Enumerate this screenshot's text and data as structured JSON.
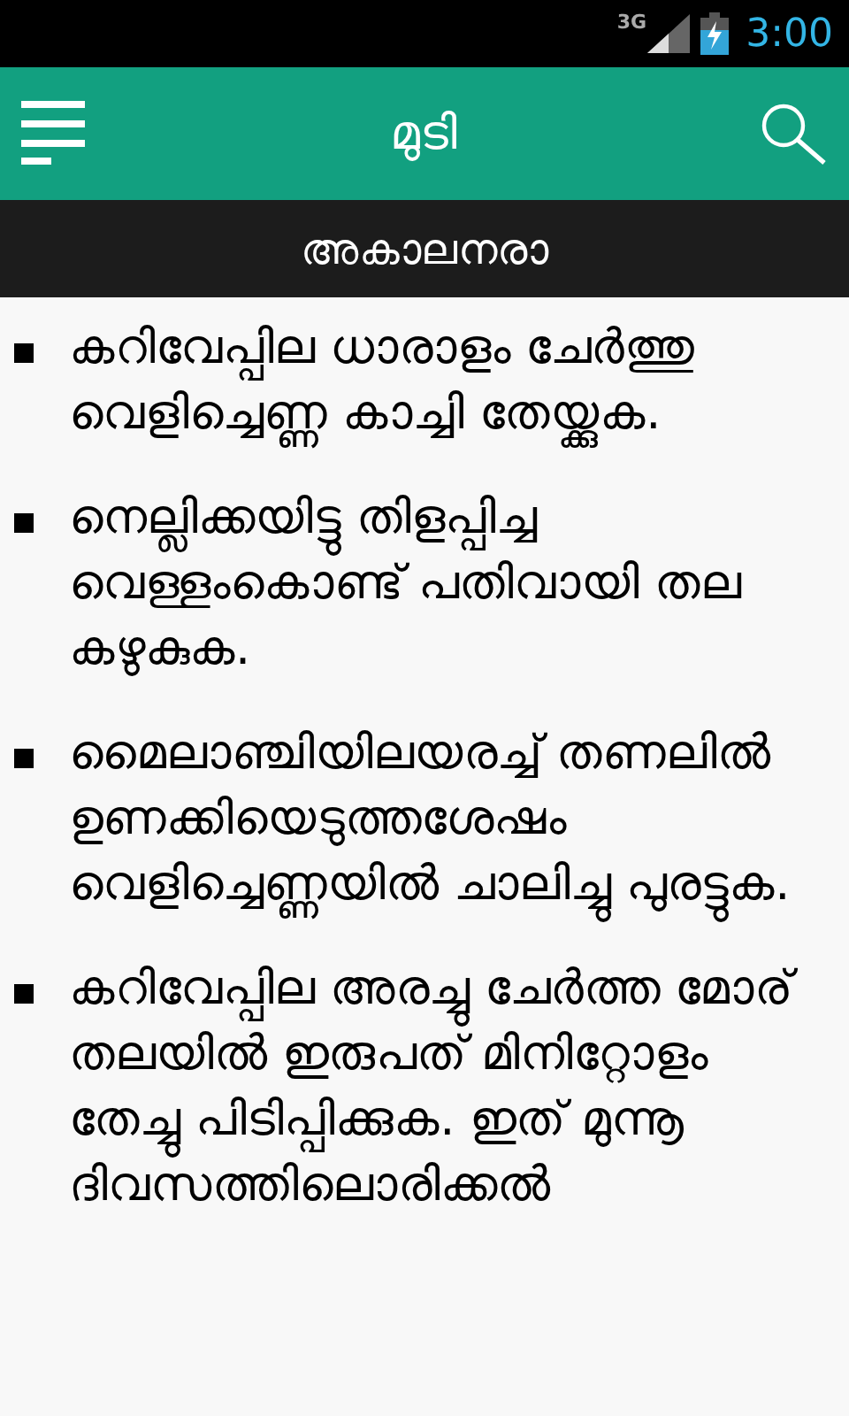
{
  "status_bar": {
    "network": "3G",
    "time": "3:00"
  },
  "app_bar": {
    "title": "മുടി"
  },
  "section": {
    "title": "അകാലനരാ"
  },
  "tips": [
    {
      "text": "കറിവേപ്പില ധാരാളം ചേർത്തു വെളിച്ചെണ്ണ കാച്ചി തേയ്ക്കുക."
    },
    {
      "text": "നെല്ലിക്കയിട്ടു  തിളപ്പിച്ച വെള്ളംകൊണ്ട് പതിവായി തല കഴുകുക."
    },
    {
      "text": "മൈലാഞ്ചിയിലയരച്ച് തണലിൽ ഉണക്കിയെടുത്തശേഷം  വെളിച്ചെണ്ണയിൽ ചാലിച്ചു പുരട്ടുക."
    },
    {
      "text": "കറിവേപ്പില അരച്ചു ചേർത്ത മോര് തലയിൽ ഇരുപത് മിനിറ്റോളം തേച്ചു പിടിപ്പിക്കുക. ഇത് മുന്നൂ ദിവസത്തിലൊരിക്കൽ"
    }
  ]
}
